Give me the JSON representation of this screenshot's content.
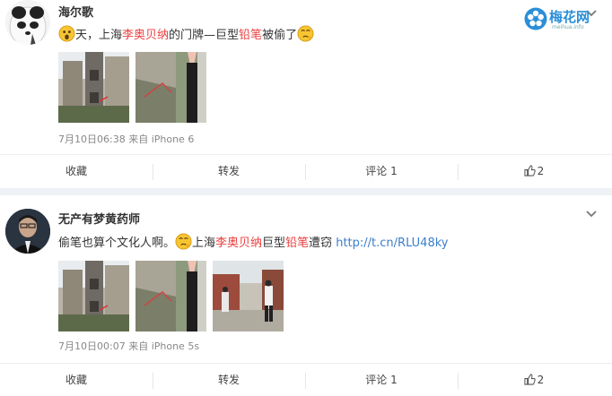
{
  "posts": [
    {
      "name": "海尔歌",
      "text_parts": [
        "天，上海",
        "李奥贝纳",
        "的门牌—巨型",
        "铅笔",
        "被偷了"
      ],
      "meta": "7月10日06:38 来自 iPhone 6",
      "actions": {
        "collect": "收藏",
        "repost": "转发",
        "comment": "评论 1",
        "like": "2"
      }
    },
    {
      "name": "无产有梦黄药师",
      "text_parts": [
        "偷笔也算个文化人啊。",
        "上海",
        "李奥贝纳",
        "巨型",
        "铅笔",
        "遭窃 ",
        "http://t.cn/RLU48ky"
      ],
      "meta": "7月10日00:07 来自 iPhone 5s",
      "actions": {
        "collect": "收藏",
        "repost": "转发",
        "comment": "评论 1",
        "like": "2"
      }
    }
  ],
  "watermark": {
    "name": "梅花网",
    "url": "meihua.info"
  },
  "colors": {
    "highlight": "#eb3f3f",
    "link": "#3b7ec9",
    "brand": "#2a8fd8"
  },
  "icons": [
    "chevron-down-icon",
    "thumbs-up-icon",
    "surprised-emoji-icon",
    "thinking-emoji-icon",
    "meihua-logo-icon"
  ]
}
